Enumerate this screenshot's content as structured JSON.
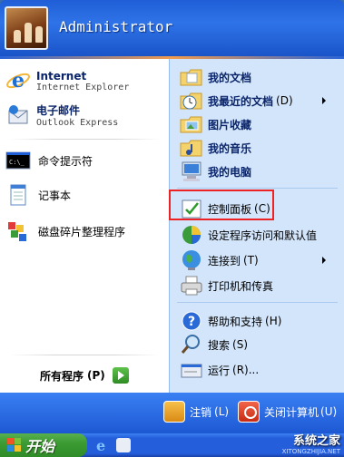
{
  "user": {
    "name": "Administrator"
  },
  "left_pinned": [
    {
      "title": "Internet",
      "subtitle": "Internet Explorer"
    },
    {
      "title": "电子邮件",
      "subtitle": "Outlook Express"
    }
  ],
  "left_recent": [
    {
      "label": "命令提示符"
    },
    {
      "label": "记事本"
    },
    {
      "label": "磁盘碎片整理程序"
    }
  ],
  "all_programs": {
    "label": "所有程序",
    "key": "(P)"
  },
  "right": {
    "my_documents": "我的文档",
    "recent_documents": "我最近的文档",
    "recent_documents_key": "(D)",
    "my_pictures": "图片收藏",
    "my_music": "我的音乐",
    "my_computer": "我的电脑",
    "control_panel": "控制面板",
    "control_panel_key": "(C)",
    "program_access": "设定程序访问和默认值",
    "connect_to": "连接到",
    "connect_to_key": "(T)",
    "printers": "打印机和传真",
    "help": "帮助和支持",
    "help_key": "(H)",
    "search": "搜索",
    "search_key": "(S)",
    "run": "运行",
    "run_key": "(R)..."
  },
  "footer": {
    "logoff": "注销",
    "logoff_key": "(L)",
    "shutdown": "关闭计算机",
    "shutdown_key": "(U)"
  },
  "taskbar": {
    "start_label": "开始"
  },
  "watermark": {
    "title": "系统之家",
    "url": "XITONGZHIJIA.NET"
  },
  "colors": {
    "highlight": "#e22222",
    "header": "#1f5ed6",
    "start_green": "#3c9b33"
  }
}
